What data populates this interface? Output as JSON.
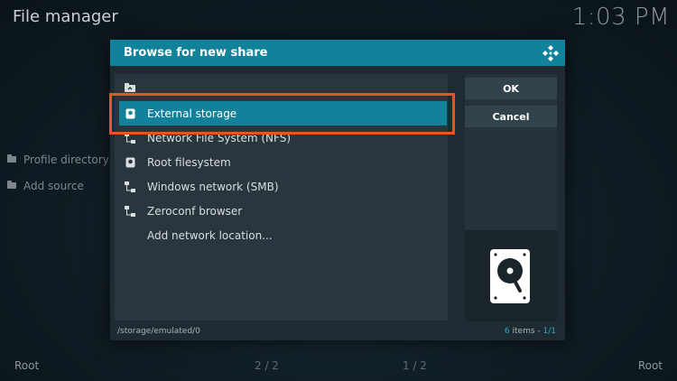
{
  "app": {
    "title": "File manager",
    "clock": "1:03 PM"
  },
  "sidebar": {
    "items": [
      {
        "label": "Profile directory"
      },
      {
        "label": "Add source"
      }
    ]
  },
  "footer": {
    "left": "Root",
    "center_left": "2 / 2",
    "center_right": "1 / 2",
    "right": "Root"
  },
  "dialog": {
    "title": "Browse for new share",
    "items": [
      {
        "label": "",
        "icon": "folder-up-icon"
      },
      {
        "label": "External storage",
        "icon": "drive-icon",
        "selected": true
      },
      {
        "label": "Network File System (NFS)",
        "icon": "network-icon"
      },
      {
        "label": "Root filesystem",
        "icon": "drive-icon"
      },
      {
        "label": "Windows network (SMB)",
        "icon": "network-icon"
      },
      {
        "label": "Zeroconf browser",
        "icon": "network-icon"
      },
      {
        "label": "Add network location...",
        "icon": ""
      }
    ],
    "ok_label": "OK",
    "cancel_label": "Cancel",
    "path": "/storage/emulated/0",
    "count_number": "6",
    "count_text": " items - ",
    "count_page": "1/1"
  },
  "colors": {
    "accent": "#12829b",
    "highlight": "#e8532a"
  }
}
